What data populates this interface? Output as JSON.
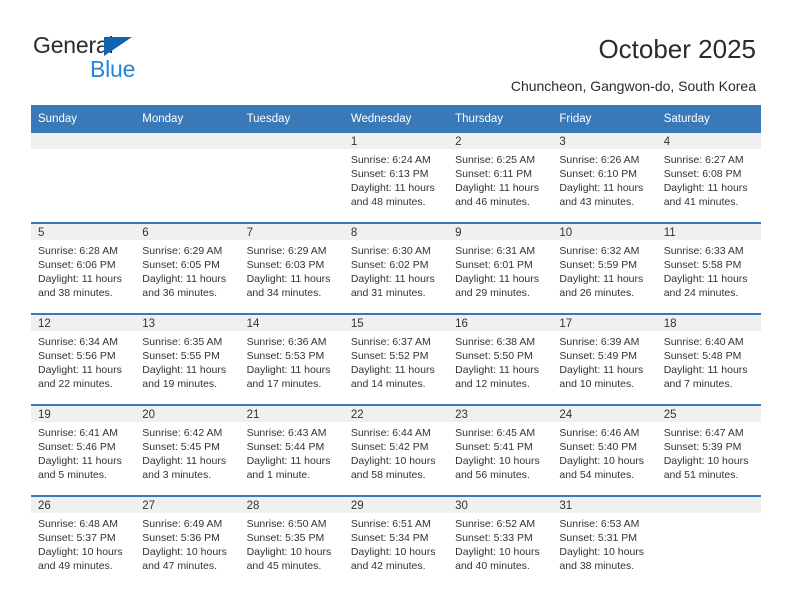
{
  "brand": {
    "name_top": "General",
    "name_bottom": "Blue",
    "triangle_color": "#1263ad",
    "blue_text_color": "#2585d6"
  },
  "header": {
    "title": "October 2025",
    "subtitle": "Chuncheon, Gangwon-do, South Korea"
  },
  "theme": {
    "header_blue": "#3a79b8",
    "daynum_band": "#f0f0f0",
    "text": "#333333"
  },
  "calendar": {
    "weekday_headers": [
      "Sunday",
      "Monday",
      "Tuesday",
      "Wednesday",
      "Thursday",
      "Friday",
      "Saturday"
    ],
    "weeks": [
      [
        {
          "day": "",
          "blank": true
        },
        {
          "day": "",
          "blank": true
        },
        {
          "day": "",
          "blank": true
        },
        {
          "day": "1",
          "sunrise": "Sunrise: 6:24 AM",
          "sunset": "Sunset: 6:13 PM",
          "daylight": "Daylight: 11 hours and 48 minutes."
        },
        {
          "day": "2",
          "sunrise": "Sunrise: 6:25 AM",
          "sunset": "Sunset: 6:11 PM",
          "daylight": "Daylight: 11 hours and 46 minutes."
        },
        {
          "day": "3",
          "sunrise": "Sunrise: 6:26 AM",
          "sunset": "Sunset: 6:10 PM",
          "daylight": "Daylight: 11 hours and 43 minutes."
        },
        {
          "day": "4",
          "sunrise": "Sunrise: 6:27 AM",
          "sunset": "Sunset: 6:08 PM",
          "daylight": "Daylight: 11 hours and 41 minutes."
        }
      ],
      [
        {
          "day": "5",
          "sunrise": "Sunrise: 6:28 AM",
          "sunset": "Sunset: 6:06 PM",
          "daylight": "Daylight: 11 hours and 38 minutes."
        },
        {
          "day": "6",
          "sunrise": "Sunrise: 6:29 AM",
          "sunset": "Sunset: 6:05 PM",
          "daylight": "Daylight: 11 hours and 36 minutes."
        },
        {
          "day": "7",
          "sunrise": "Sunrise: 6:29 AM",
          "sunset": "Sunset: 6:03 PM",
          "daylight": "Daylight: 11 hours and 34 minutes."
        },
        {
          "day": "8",
          "sunrise": "Sunrise: 6:30 AM",
          "sunset": "Sunset: 6:02 PM",
          "daylight": "Daylight: 11 hours and 31 minutes."
        },
        {
          "day": "9",
          "sunrise": "Sunrise: 6:31 AM",
          "sunset": "Sunset: 6:01 PM",
          "daylight": "Daylight: 11 hours and 29 minutes."
        },
        {
          "day": "10",
          "sunrise": "Sunrise: 6:32 AM",
          "sunset": "Sunset: 5:59 PM",
          "daylight": "Daylight: 11 hours and 26 minutes."
        },
        {
          "day": "11",
          "sunrise": "Sunrise: 6:33 AM",
          "sunset": "Sunset: 5:58 PM",
          "daylight": "Daylight: 11 hours and 24 minutes."
        }
      ],
      [
        {
          "day": "12",
          "sunrise": "Sunrise: 6:34 AM",
          "sunset": "Sunset: 5:56 PM",
          "daylight": "Daylight: 11 hours and 22 minutes."
        },
        {
          "day": "13",
          "sunrise": "Sunrise: 6:35 AM",
          "sunset": "Sunset: 5:55 PM",
          "daylight": "Daylight: 11 hours and 19 minutes."
        },
        {
          "day": "14",
          "sunrise": "Sunrise: 6:36 AM",
          "sunset": "Sunset: 5:53 PM",
          "daylight": "Daylight: 11 hours and 17 minutes."
        },
        {
          "day": "15",
          "sunrise": "Sunrise: 6:37 AM",
          "sunset": "Sunset: 5:52 PM",
          "daylight": "Daylight: 11 hours and 14 minutes."
        },
        {
          "day": "16",
          "sunrise": "Sunrise: 6:38 AM",
          "sunset": "Sunset: 5:50 PM",
          "daylight": "Daylight: 11 hours and 12 minutes."
        },
        {
          "day": "17",
          "sunrise": "Sunrise: 6:39 AM",
          "sunset": "Sunset: 5:49 PM",
          "daylight": "Daylight: 11 hours and 10 minutes."
        },
        {
          "day": "18",
          "sunrise": "Sunrise: 6:40 AM",
          "sunset": "Sunset: 5:48 PM",
          "daylight": "Daylight: 11 hours and 7 minutes."
        }
      ],
      [
        {
          "day": "19",
          "sunrise": "Sunrise: 6:41 AM",
          "sunset": "Sunset: 5:46 PM",
          "daylight": "Daylight: 11 hours and 5 minutes."
        },
        {
          "day": "20",
          "sunrise": "Sunrise: 6:42 AM",
          "sunset": "Sunset: 5:45 PM",
          "daylight": "Daylight: 11 hours and 3 minutes."
        },
        {
          "day": "21",
          "sunrise": "Sunrise: 6:43 AM",
          "sunset": "Sunset: 5:44 PM",
          "daylight": "Daylight: 11 hours and 1 minute."
        },
        {
          "day": "22",
          "sunrise": "Sunrise: 6:44 AM",
          "sunset": "Sunset: 5:42 PM",
          "daylight": "Daylight: 10 hours and 58 minutes."
        },
        {
          "day": "23",
          "sunrise": "Sunrise: 6:45 AM",
          "sunset": "Sunset: 5:41 PM",
          "daylight": "Daylight: 10 hours and 56 minutes."
        },
        {
          "day": "24",
          "sunrise": "Sunrise: 6:46 AM",
          "sunset": "Sunset: 5:40 PM",
          "daylight": "Daylight: 10 hours and 54 minutes."
        },
        {
          "day": "25",
          "sunrise": "Sunrise: 6:47 AM",
          "sunset": "Sunset: 5:39 PM",
          "daylight": "Daylight: 10 hours and 51 minutes."
        }
      ],
      [
        {
          "day": "26",
          "sunrise": "Sunrise: 6:48 AM",
          "sunset": "Sunset: 5:37 PM",
          "daylight": "Daylight: 10 hours and 49 minutes."
        },
        {
          "day": "27",
          "sunrise": "Sunrise: 6:49 AM",
          "sunset": "Sunset: 5:36 PM",
          "daylight": "Daylight: 10 hours and 47 minutes."
        },
        {
          "day": "28",
          "sunrise": "Sunrise: 6:50 AM",
          "sunset": "Sunset: 5:35 PM",
          "daylight": "Daylight: 10 hours and 45 minutes."
        },
        {
          "day": "29",
          "sunrise": "Sunrise: 6:51 AM",
          "sunset": "Sunset: 5:34 PM",
          "daylight": "Daylight: 10 hours and 42 minutes."
        },
        {
          "day": "30",
          "sunrise": "Sunrise: 6:52 AM",
          "sunset": "Sunset: 5:33 PM",
          "daylight": "Daylight: 10 hours and 40 minutes."
        },
        {
          "day": "31",
          "sunrise": "Sunrise: 6:53 AM",
          "sunset": "Sunset: 5:31 PM",
          "daylight": "Daylight: 10 hours and 38 minutes."
        },
        {
          "day": "",
          "blank": true
        }
      ]
    ]
  }
}
